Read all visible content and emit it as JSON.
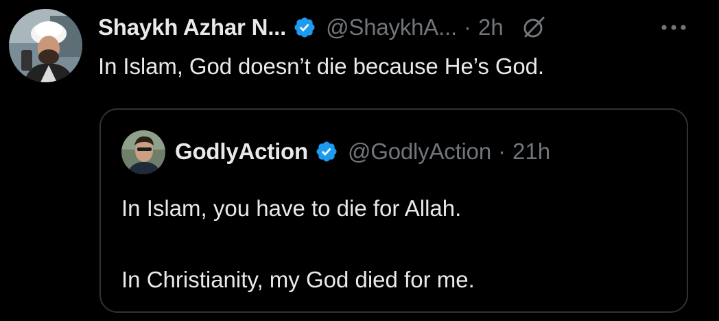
{
  "tweet": {
    "author": {
      "display_name": "Shaykh Azhar N...",
      "handle": "@ShaykhA...",
      "verified": true
    },
    "separator": "·",
    "time": "2h",
    "text": "In Islam, God doesn’t die because He’s God.",
    "icons": {
      "avatar": "profile-photo",
      "verified": "verified-badge-icon",
      "grok": "grok-icon",
      "more": "more-options-icon"
    }
  },
  "quoted_tweet": {
    "author": {
      "display_name": "GodlyAction",
      "handle": "@GodlyAction",
      "verified": true
    },
    "separator": "·",
    "time": "21h",
    "text_line1": "In Islam, you have to die for Allah.",
    "text_line2": "In Christianity, my God died for me."
  },
  "colors": {
    "background": "#000000",
    "primary_text": "#e7e9ea",
    "secondary_text": "#71767b",
    "verified_blue": "#1d9bf0",
    "border": "#2f3336"
  }
}
